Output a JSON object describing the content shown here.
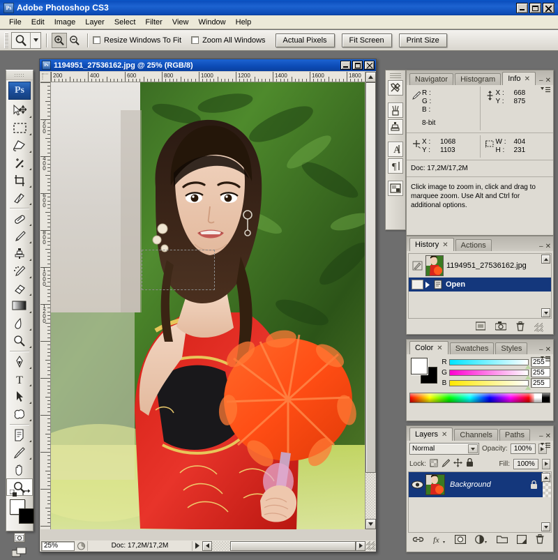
{
  "app": {
    "title": "Adobe Photoshop CS3",
    "logo_text": "Ps",
    "window_buttons": [
      "minimize",
      "maximize",
      "close"
    ]
  },
  "menubar": {
    "items": [
      "File",
      "Edit",
      "Image",
      "Layer",
      "Select",
      "Filter",
      "View",
      "Window",
      "Help"
    ]
  },
  "options_bar": {
    "active_tool": "zoom-tool",
    "zoom_in_label": "zoom-in",
    "zoom_out_label": "zoom-out",
    "checkboxes": [
      {
        "label": "Resize Windows To Fit",
        "checked": false
      },
      {
        "label": "Zoom All Windows",
        "checked": false
      }
    ],
    "buttons": [
      "Actual Pixels",
      "Fit Screen",
      "Print Size"
    ]
  },
  "toolbox": {
    "logo": "Ps",
    "tools": [
      {
        "name": "move-tool",
        "glyph": "move",
        "has_submenu": true,
        "selected": false
      },
      {
        "name": "rectangular-marquee-tool",
        "glyph": "marquee",
        "has_submenu": true,
        "selected": false
      },
      {
        "name": "lasso-tool",
        "glyph": "lasso",
        "has_submenu": true,
        "selected": false
      },
      {
        "name": "magic-wand-tool",
        "glyph": "wand",
        "has_submenu": true,
        "selected": false
      },
      {
        "name": "crop-tool",
        "glyph": "crop",
        "has_submenu": true,
        "selected": false
      },
      {
        "name": "slice-tool",
        "glyph": "slice",
        "has_submenu": true,
        "selected": false
      },
      {
        "name": "healing-brush-tool",
        "glyph": "healing",
        "has_submenu": true,
        "selected": false
      },
      {
        "name": "brush-tool",
        "glyph": "brush",
        "has_submenu": true,
        "selected": false
      },
      {
        "name": "clone-stamp-tool",
        "glyph": "stamp",
        "has_submenu": true,
        "selected": false
      },
      {
        "name": "history-brush-tool",
        "glyph": "historybrush",
        "has_submenu": true,
        "selected": false
      },
      {
        "name": "eraser-tool",
        "glyph": "eraser",
        "has_submenu": true,
        "selected": false
      },
      {
        "name": "gradient-tool",
        "glyph": "gradient",
        "has_submenu": true,
        "selected": false
      },
      {
        "name": "blur-tool",
        "glyph": "blur",
        "has_submenu": true,
        "selected": false
      },
      {
        "name": "dodge-tool",
        "glyph": "dodge",
        "has_submenu": true,
        "selected": false
      },
      {
        "name": "pen-tool",
        "glyph": "pen",
        "has_submenu": true,
        "selected": false
      },
      {
        "name": "horizontal-type-tool",
        "glyph": "type",
        "has_submenu": true,
        "selected": false
      },
      {
        "name": "path-selection-tool",
        "glyph": "pathselect",
        "has_submenu": true,
        "selected": false
      },
      {
        "name": "custom-shape-tool",
        "glyph": "shape",
        "has_submenu": true,
        "selected": false
      },
      {
        "name": "notes-tool",
        "glyph": "notes",
        "has_submenu": true,
        "selected": false
      },
      {
        "name": "eyedropper-tool",
        "glyph": "eyedropper",
        "has_submenu": true,
        "selected": false
      },
      {
        "name": "hand-tool",
        "glyph": "hand",
        "has_submenu": false,
        "selected": false
      },
      {
        "name": "zoom-tool",
        "glyph": "zoom",
        "has_submenu": false,
        "selected": true
      }
    ],
    "foreground_color": "#ffffff",
    "background_color": "#000000",
    "quickmask_modes": [
      "standard-mask",
      "quick-mask"
    ],
    "screen_mode": "standard-screen-mode"
  },
  "document": {
    "title": "1194951_27536162.jpg @ 25% (RGB/8)",
    "zoom": "25%",
    "doc_size": "Doc: 17,2M/17,2M",
    "ruler_h_labels": [
      "200",
      "400",
      "600",
      "800",
      "1000",
      "1200",
      "1400",
      "1600",
      "1800"
    ],
    "ruler_v_labels": [
      "200",
      "400",
      "600",
      "800",
      "1000",
      "1200"
    ],
    "selection": {
      "name": "marquee-selection",
      "visible": true
    }
  },
  "dock_strip": {
    "buttons": [
      {
        "name": "tool-presets-icon",
        "glyph": "tools"
      },
      {
        "name": "brushes-icon",
        "glyph": "brushes"
      },
      {
        "name": "clone-source-icon",
        "glyph": "clonesource"
      },
      {
        "name": "character-icon",
        "glyph": "character"
      },
      {
        "name": "paragraph-icon",
        "glyph": "paragraph"
      },
      {
        "name": "layer-comps-icon",
        "glyph": "layercomps"
      }
    ]
  },
  "info_palette": {
    "tabs": [
      {
        "label": "Navigator",
        "active": false,
        "closable": false
      },
      {
        "label": "Histogram",
        "active": false,
        "closable": false
      },
      {
        "label": "Info",
        "active": true,
        "closable": true
      }
    ],
    "color_readout": {
      "icon": "eyedropper-icon",
      "rows": [
        {
          "label": "R :",
          "value": ""
        },
        {
          "label": "G :",
          "value": ""
        },
        {
          "label": "B :",
          "value": ""
        }
      ],
      "depth": "8-bit"
    },
    "pointer_readout": {
      "icon": "crosshair-icon",
      "rows": [
        {
          "label": "X :",
          "value": "1068"
        },
        {
          "label": "Y :",
          "value": "1103"
        }
      ]
    },
    "second_readout": {
      "icon": "vertical-arrow-icon",
      "rows": [
        {
          "label": "X :",
          "value": "668"
        },
        {
          "label": "Y :",
          "value": "875"
        }
      ]
    },
    "selection_readout": {
      "icon": "marquee-icon",
      "rows": [
        {
          "label": "W :",
          "value": "404"
        },
        {
          "label": "H :",
          "value": "231"
        }
      ]
    },
    "doc_line": "Doc: 17,2M/17,2M",
    "hint": "Click image to zoom in, click and drag to marquee zoom.  Use Alt and Ctrl for additional options."
  },
  "history_palette": {
    "tabs": [
      {
        "label": "History",
        "active": true,
        "closable": true
      },
      {
        "label": "Actions",
        "active": false,
        "closable": false
      }
    ],
    "snapshot": {
      "name": "1194951_27536162.jpg",
      "icon": "history-source-icon"
    },
    "states": [
      {
        "label": "Open",
        "selected": true,
        "icon": "open-state-icon"
      }
    ],
    "footer_buttons": [
      {
        "name": "new-document-from-state-button",
        "glyph": "newdoc"
      },
      {
        "name": "new-snapshot-button",
        "glyph": "camera"
      },
      {
        "name": "delete-state-button",
        "glyph": "trash"
      }
    ]
  },
  "color_palette": {
    "tabs": [
      {
        "label": "Color",
        "active": true,
        "closable": true
      },
      {
        "label": "Swatches",
        "active": false,
        "closable": false
      },
      {
        "label": "Styles",
        "active": false,
        "closable": false
      }
    ],
    "foreground": "#ffffff",
    "background": "#000000",
    "channels": [
      {
        "label": "R",
        "value": "255",
        "from": "#00e5ff",
        "to": "#ffffff"
      },
      {
        "label": "G",
        "value": "255",
        "from": "#ff00d0",
        "to": "#ffffff"
      },
      {
        "label": "B",
        "value": "255",
        "from": "#ffe800",
        "to": "#ffffff"
      }
    ]
  },
  "layers_palette": {
    "tabs": [
      {
        "label": "Layers",
        "active": true,
        "closable": true
      },
      {
        "label": "Channels",
        "active": false,
        "closable": false
      },
      {
        "label": "Paths",
        "active": false,
        "closable": false
      }
    ],
    "blend_mode": "Normal",
    "opacity_label": "Opacity:",
    "opacity_value": "100%",
    "lock_label": "Lock:",
    "lock_icons": [
      "lock-transparency-icon",
      "lock-image-icon",
      "lock-position-icon",
      "lock-all-icon"
    ],
    "fill_label": "Fill:",
    "fill_value": "100%",
    "layers": [
      {
        "name": "Background",
        "visible": true,
        "locked": true,
        "selected": true,
        "italic": true
      }
    ],
    "footer_buttons": [
      {
        "name": "link-layers-button",
        "glyph": "link"
      },
      {
        "name": "layer-style-button",
        "glyph": "fx"
      },
      {
        "name": "layer-mask-button",
        "glyph": "mask"
      },
      {
        "name": "adjustment-layer-button",
        "glyph": "adjust"
      },
      {
        "name": "new-group-button",
        "glyph": "folder"
      },
      {
        "name": "new-layer-button",
        "glyph": "newlayer"
      },
      {
        "name": "delete-layer-button",
        "glyph": "trash"
      }
    ]
  },
  "colors": {
    "title_blue": "#0c4fbe",
    "selection_blue": "#14377c",
    "panel_gray": "#dedbd3",
    "menu_bg": "#ece9d8"
  }
}
